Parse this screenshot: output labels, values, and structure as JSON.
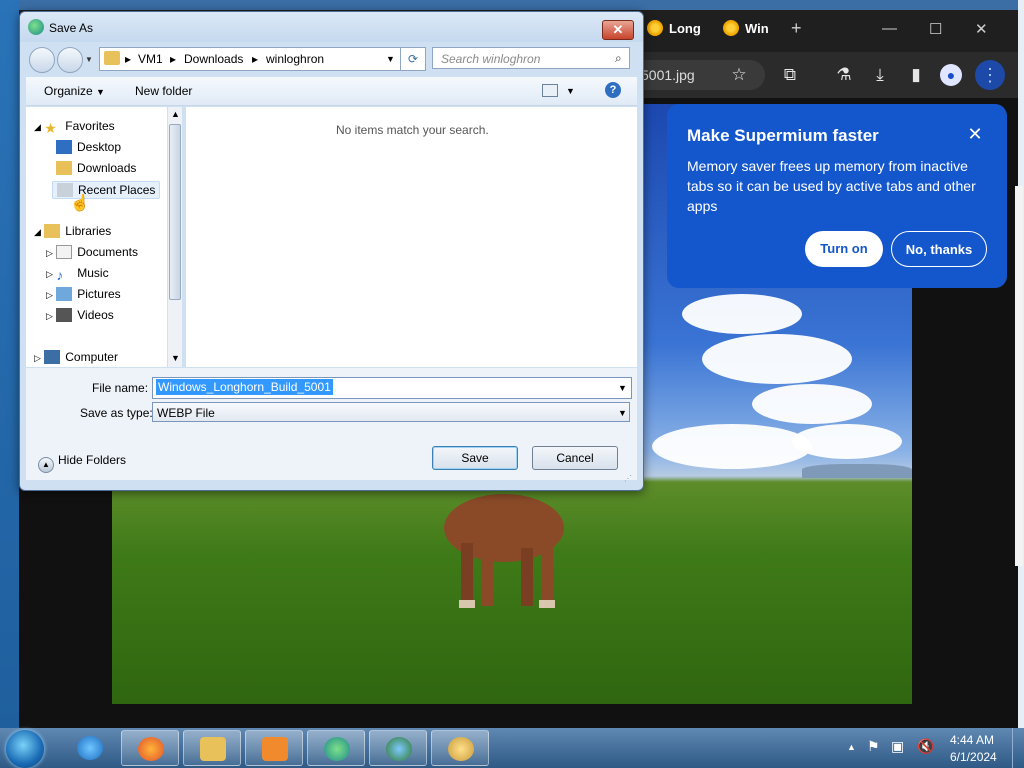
{
  "browser": {
    "tabs": [
      {
        "label": "Long"
      },
      {
        "label": "Win"
      }
    ],
    "new_tab": "+",
    "min": "—",
    "max": "☐",
    "close": "✕",
    "url_fragment": "5001.jpg"
  },
  "popup": {
    "title": "Make Supermium faster",
    "body": "Memory saver frees up memory from inactive tabs so it can be used by active tabs and other apps",
    "close": "✕",
    "turn_on": "Turn on",
    "no_thanks": "No, thanks"
  },
  "dialog": {
    "title": "Save As",
    "close": "✕",
    "breadcrumb": [
      "VM1",
      "Downloads",
      "winloghron"
    ],
    "search_placeholder": "Search winloghron",
    "organize": "Organize",
    "new_folder": "New folder",
    "help": "?",
    "tree": {
      "favorites": "Favorites",
      "desktop": "Desktop",
      "downloads": "Downloads",
      "recent_places": "Recent Places",
      "libraries": "Libraries",
      "documents": "Documents",
      "music": "Music",
      "pictures": "Pictures",
      "videos": "Videos",
      "computer": "Computer"
    },
    "empty_message": "No items match your search.",
    "file_name_label": "File name:",
    "file_name_value": "Windows_Longhorn_Build_5001",
    "save_as_type_label": "Save as type:",
    "save_as_type_value": "WEBP File",
    "save": "Save",
    "cancel": "Cancel",
    "hide_folders": "Hide Folders"
  },
  "taskbar": {
    "time": "4:44 AM",
    "date": "6/1/2024"
  },
  "colors": {
    "popup_bg": "#1457cc",
    "selection": "#3399ff",
    "taskbar": "#2f5a86"
  }
}
